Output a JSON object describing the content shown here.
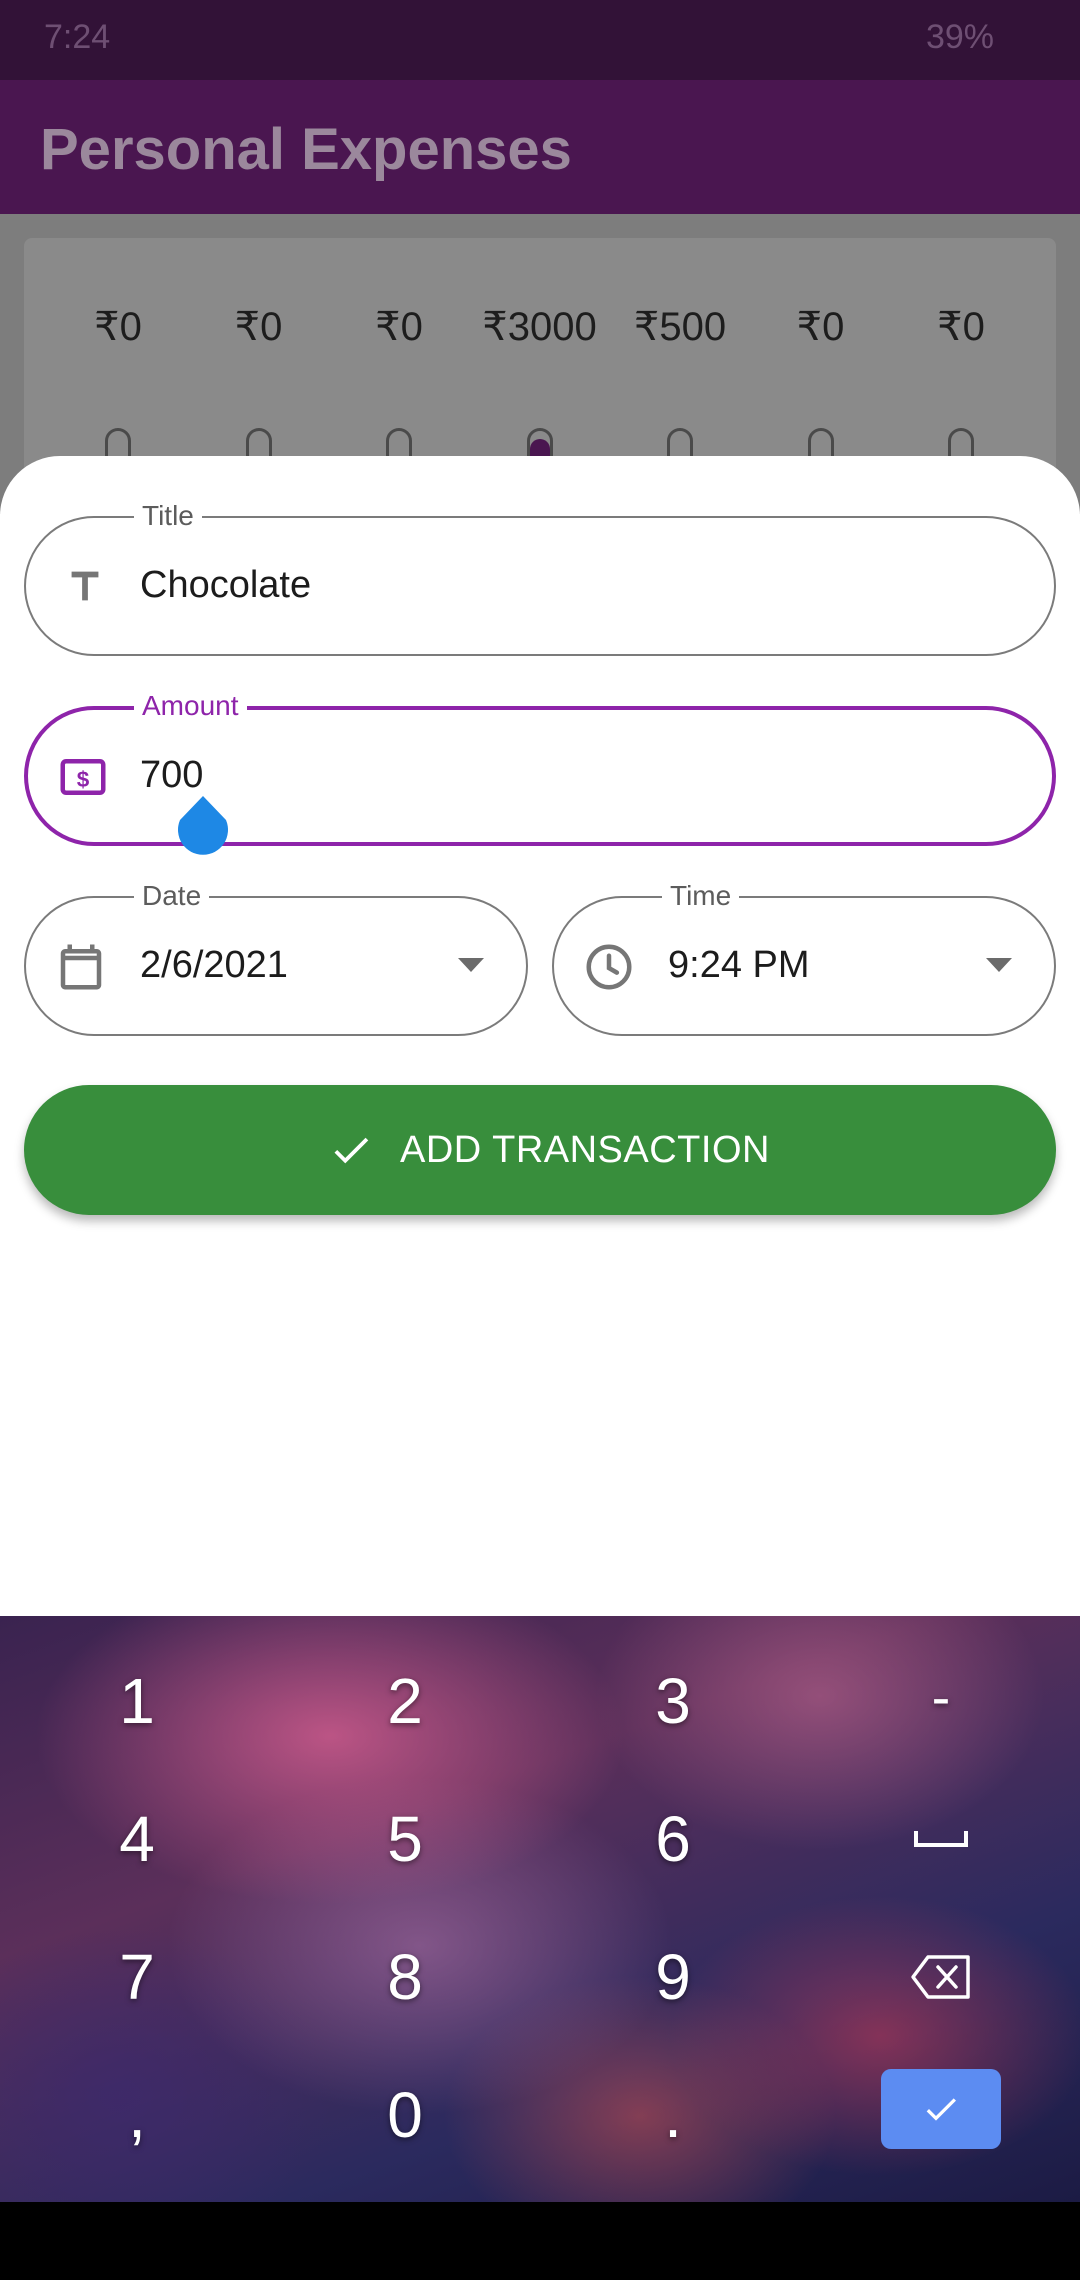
{
  "status_bar": {
    "time": "7:24",
    "battery": "39%"
  },
  "app_bar": {
    "title": "Personal Expenses"
  },
  "chart": {
    "bars": [
      {
        "label": "₹0",
        "fill": 0
      },
      {
        "label": "₹0",
        "fill": 0
      },
      {
        "label": "₹0",
        "fill": 0
      },
      {
        "label": "₹3000",
        "fill": 0.857
      },
      {
        "label": "₹500",
        "fill": 0.143
      },
      {
        "label": "₹0",
        "fill": 0
      },
      {
        "label": "₹0",
        "fill": 0
      }
    ]
  },
  "form": {
    "title": {
      "label": "Title",
      "value": "Chocolate",
      "icon": "text-icon"
    },
    "amount": {
      "label": "Amount",
      "value": "700",
      "icon": "dollar-icon"
    },
    "date": {
      "label": "Date",
      "value": "2/6/2021",
      "icon": "calendar-icon"
    },
    "time": {
      "label": "Time",
      "value": "9:24 PM",
      "icon": "clock-icon"
    },
    "submit": {
      "label": "ADD TRANSACTION",
      "icon": "check-icon"
    }
  },
  "keyboard": {
    "rows": [
      [
        "1",
        "2",
        "3",
        "-"
      ],
      [
        "4",
        "5",
        "6",
        "space"
      ],
      [
        "7",
        "8",
        "9",
        "backspace"
      ],
      [
        ",",
        "0",
        ".",
        "done"
      ]
    ],
    "keys": {
      "k1": "1",
      "k2": "2",
      "k3": "3",
      "kminus": "-",
      "k4": "4",
      "k5": "5",
      "k6": "6",
      "k7": "7",
      "k8": "8",
      "k9": "9",
      "kcomma": ",",
      "k0": "0",
      "kdot": "."
    }
  },
  "colors": {
    "primary": "#8e24aa",
    "app_bar": "#4a1650",
    "button_green": "#388e3c",
    "done_key": "#5c8cf2"
  }
}
